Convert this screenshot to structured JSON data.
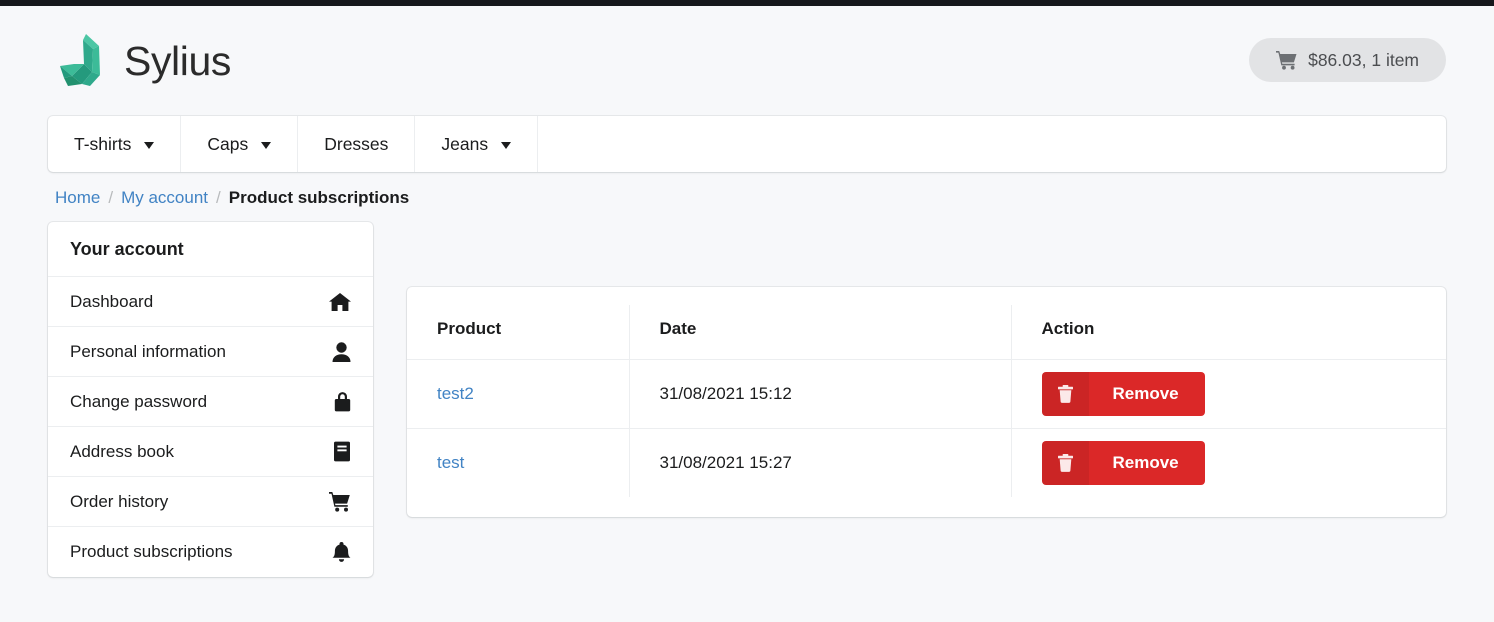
{
  "brand": {
    "name": "Sylius",
    "logo_icon": "sylius-swan-logo"
  },
  "cart": {
    "icon": "shopping-cart-icon",
    "label": "$86.03, 1 item"
  },
  "nav": {
    "items": [
      {
        "label": "T-shirts",
        "has_dropdown": true
      },
      {
        "label": "Caps",
        "has_dropdown": true
      },
      {
        "label": "Dresses",
        "has_dropdown": false
      },
      {
        "label": "Jeans",
        "has_dropdown": true
      }
    ]
  },
  "breadcrumb": {
    "home": "Home",
    "account": "My account",
    "current": "Product subscriptions",
    "separator": "/"
  },
  "sidebar": {
    "title": "Your account",
    "items": [
      {
        "label": "Dashboard",
        "icon": "home-icon"
      },
      {
        "label": "Personal information",
        "icon": "user-icon"
      },
      {
        "label": "Change password",
        "icon": "lock-icon"
      },
      {
        "label": "Address book",
        "icon": "book-icon"
      },
      {
        "label": "Order history",
        "icon": "cart-icon"
      },
      {
        "label": "Product subscriptions",
        "icon": "bell-icon"
      }
    ]
  },
  "table": {
    "columns": [
      "Product",
      "Date",
      "Action"
    ],
    "rows": [
      {
        "product": "test2",
        "date": "31/08/2021 15:12",
        "action_label": "Remove",
        "action_icon": "trash-icon"
      },
      {
        "product": "test",
        "date": "31/08/2021 15:27",
        "action_label": "Remove",
        "action_icon": "trash-icon"
      }
    ]
  },
  "colors": {
    "brand_green": "#2ba888",
    "link_blue": "#4183c4",
    "danger_red": "#db2828",
    "page_bg": "#f7f8fa",
    "topbar": "#16181c"
  }
}
